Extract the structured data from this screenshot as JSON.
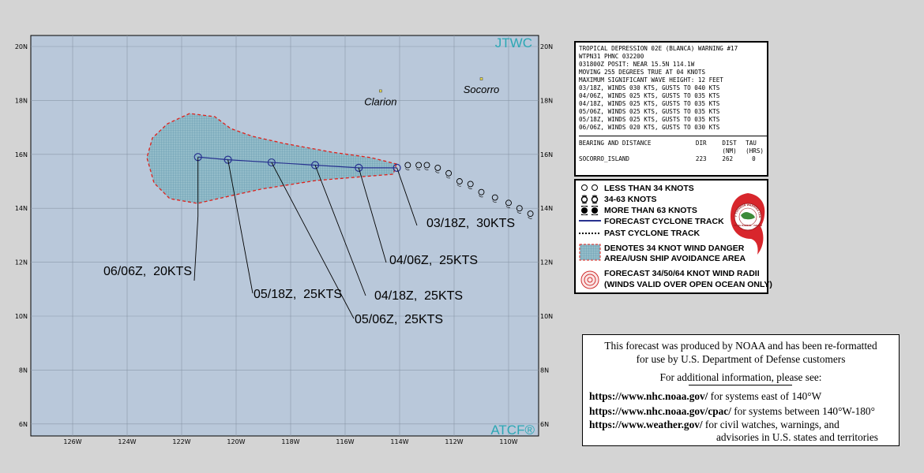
{
  "map": {
    "agency_top": "JTWC",
    "agency_bottom": "ATCF®",
    "lat_labels": [
      "20N",
      "18N",
      "16N",
      "14N",
      "12N",
      "10N",
      "8N",
      "6N"
    ],
    "lon_labels": [
      "126W",
      "124W",
      "122W",
      "120W",
      "118W",
      "116W",
      "114W",
      "112W",
      "110W"
    ],
    "places": [
      {
        "name": "Clarion",
        "lat": 18.35,
        "lon": -114.7
      },
      {
        "name": "Socorro",
        "lat": 18.8,
        "lon": -111.0
      }
    ],
    "forecast_track": [
      {
        "label": "03/18Z,  30KTS",
        "lat": 15.5,
        "lon": -114.1
      },
      {
        "label": "04/06Z,  25KTS",
        "lat": 15.5,
        "lon": -115.5
      },
      {
        "label": "04/18Z,  25KTS",
        "lat": 15.6,
        "lon": -117.1
      },
      {
        "label": "05/06Z,  25KTS",
        "lat": 15.7,
        "lon": -118.7
      },
      {
        "label": "05/18Z,  25KTS",
        "lat": 15.8,
        "lon": -120.3
      },
      {
        "label": "06/06Z,  20KTS",
        "lat": 15.9,
        "lon": -121.4
      }
    ],
    "past_track": [
      {
        "lat": 15.6,
        "lon": -113.7
      },
      {
        "lat": 15.6,
        "lon": -113.3
      },
      {
        "lat": 15.6,
        "lon": -113.0
      },
      {
        "lat": 15.5,
        "lon": -112.6
      },
      {
        "lat": 15.3,
        "lon": -112.2
      },
      {
        "lat": 15.0,
        "lon": -111.8
      },
      {
        "lat": 14.9,
        "lon": -111.4
      },
      {
        "lat": 14.6,
        "lon": -111.0
      },
      {
        "lat": 14.4,
        "lon": -110.5
      },
      {
        "lat": 14.2,
        "lon": -110.0
      },
      {
        "lat": 14.0,
        "lon": -109.6
      },
      {
        "lat": 13.8,
        "lon": -109.2
      }
    ],
    "colors": {
      "ocean": "#b9c8da",
      "track": "#27318f",
      "danger_fill": "#8fb9c7",
      "danger_border": "#e0201a",
      "agency": "#2ca7b4"
    }
  },
  "warning": {
    "lines": [
      "TROPICAL DEPRESSION 02E (BLANCA) WARNING #17",
      "WTPN31 PHNC 032200",
      "031800Z POSIT: NEAR 15.5N 114.1W",
      "MOVING 255 DEGREES TRUE AT 04 KNOTS",
      "MAXIMUM SIGNIFICANT WAVE HEIGHT: 12 FEET",
      "03/18Z, WINDS 030 KTS, GUSTS TO 040 KTS",
      "04/06Z, WINDS 025 KTS, GUSTS TO 035 KTS",
      "04/18Z, WINDS 025 KTS, GUSTS TO 035 KTS",
      "05/06Z, WINDS 025 KTS, GUSTS TO 035 KTS",
      "05/18Z, WINDS 025 KTS, GUSTS TO 035 KTS",
      "06/06Z, WINDS 020 KTS, GUSTS TO 030 KTS"
    ],
    "table_header": [
      "BEARING AND DISTANCE",
      "DIR",
      "DIST",
      "TAU"
    ],
    "table_units": [
      "",
      "",
      "(NM)",
      "(HRS)"
    ],
    "table_row": [
      "SOCORRO_ISLAND",
      "223",
      "262",
      "0"
    ]
  },
  "legend": {
    "items": [
      "LESS THAN 34 KNOTS",
      "34-63 KNOTS",
      "MORE THAN 63 KNOTS",
      "FORECAST CYCLONE TRACK",
      "PAST CYCLONE TRACK",
      "DENOTES 34 KNOT WIND DANGER",
      "AREA/USN SHIP AVOIDANCE AREA",
      "FORECAST 34/50/64 KNOT WIND RADII",
      "(WINDS VALID OVER OPEN OCEAN ONLY)"
    ],
    "seal_text": "JOINT TYPHOON WARNING CENTER",
    "seal_text_bottom": "PEARL HARBOR · HAWAII"
  },
  "info": {
    "line1": "This forecast was produced by NOAA and has been re-formatted",
    "line2": "for use by U.S. Department of Defense customers",
    "line3": "For additional information, please see:",
    "links": [
      {
        "url": "https://www.nhc.noaa.gov/",
        "desc": "  for systems east of 140°W"
      },
      {
        "url": "https://www.nhc.noaa.gov/cpac/",
        "desc": "  for systems between 140°W-180°"
      },
      {
        "url": "https://www.weather.gov/",
        "desc": "  for civil watches, warnings, and"
      }
    ],
    "line_last": "advisories in U.S. states and territories"
  }
}
